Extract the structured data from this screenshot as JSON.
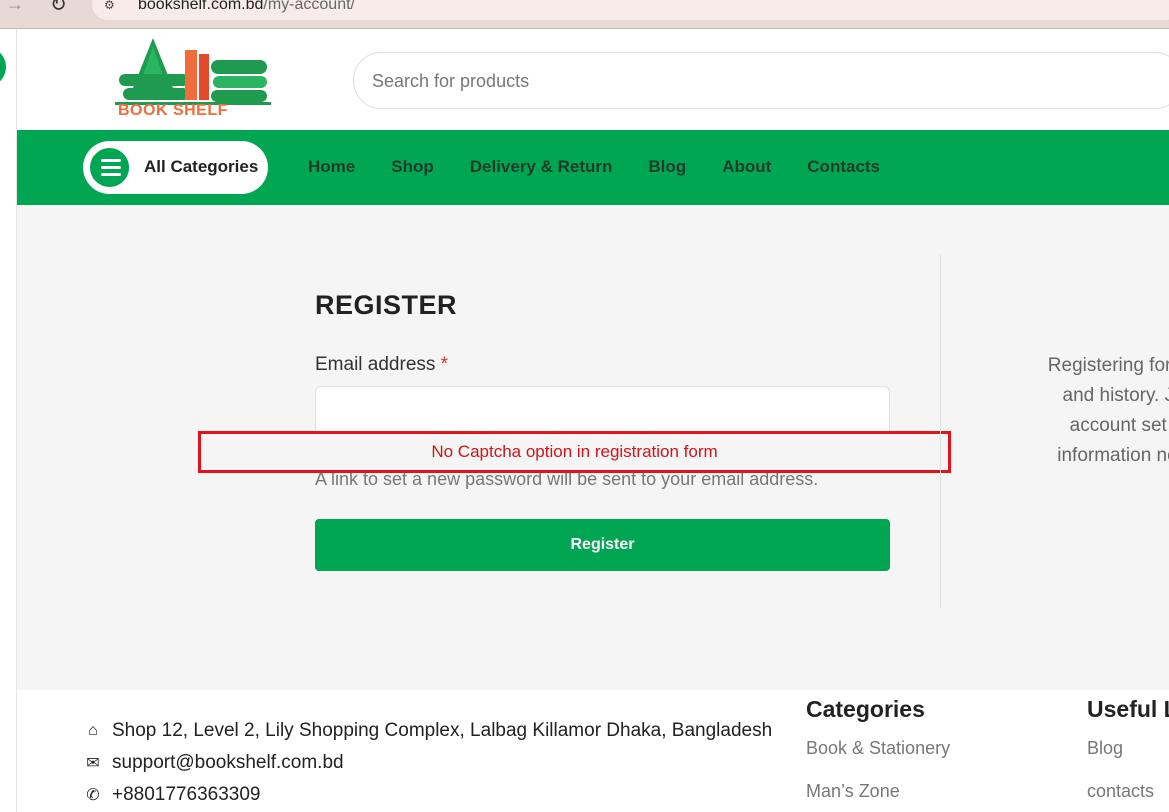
{
  "browser": {
    "url_host": "bookshelf.com.bd",
    "url_path": "/my-account/"
  },
  "header": {
    "logo_text": "BOOK SHELF",
    "search_placeholder": "Search for products"
  },
  "nav": {
    "categories_label": "All Categories",
    "items": [
      "Home",
      "Shop",
      "Delivery & Return",
      "Blog",
      "About",
      "Contacts"
    ]
  },
  "register": {
    "title": "REGISTER",
    "email_label": "Email address",
    "required_mark": "*",
    "email_value": "",
    "hint": "A link to set a new password will be sent to your email address.",
    "button_label": "Register"
  },
  "annotation": {
    "text": "No Captcha option in registration form",
    "color": "#e3121b"
  },
  "side_text": {
    "lines": [
      "Registering for this",
      "and history. Just",
      "account set up fo",
      "information necess"
    ]
  },
  "footer": {
    "address": "Shop 12, Level 2, Lily Shopping Complex, Lalbag Killamor Dhaka, Bangladesh",
    "email": "support@bookshelf.com.bd",
    "phone": "+8801776363309",
    "categories_title": "Categories",
    "categories_links": [
      "Book & Stationery",
      "Man’s Zone"
    ],
    "useful_title": "Useful L",
    "useful_links": [
      "Blog",
      "contacts"
    ]
  },
  "colors": {
    "brand_green": "#00a651",
    "logo_orange": "#f26b3a"
  }
}
